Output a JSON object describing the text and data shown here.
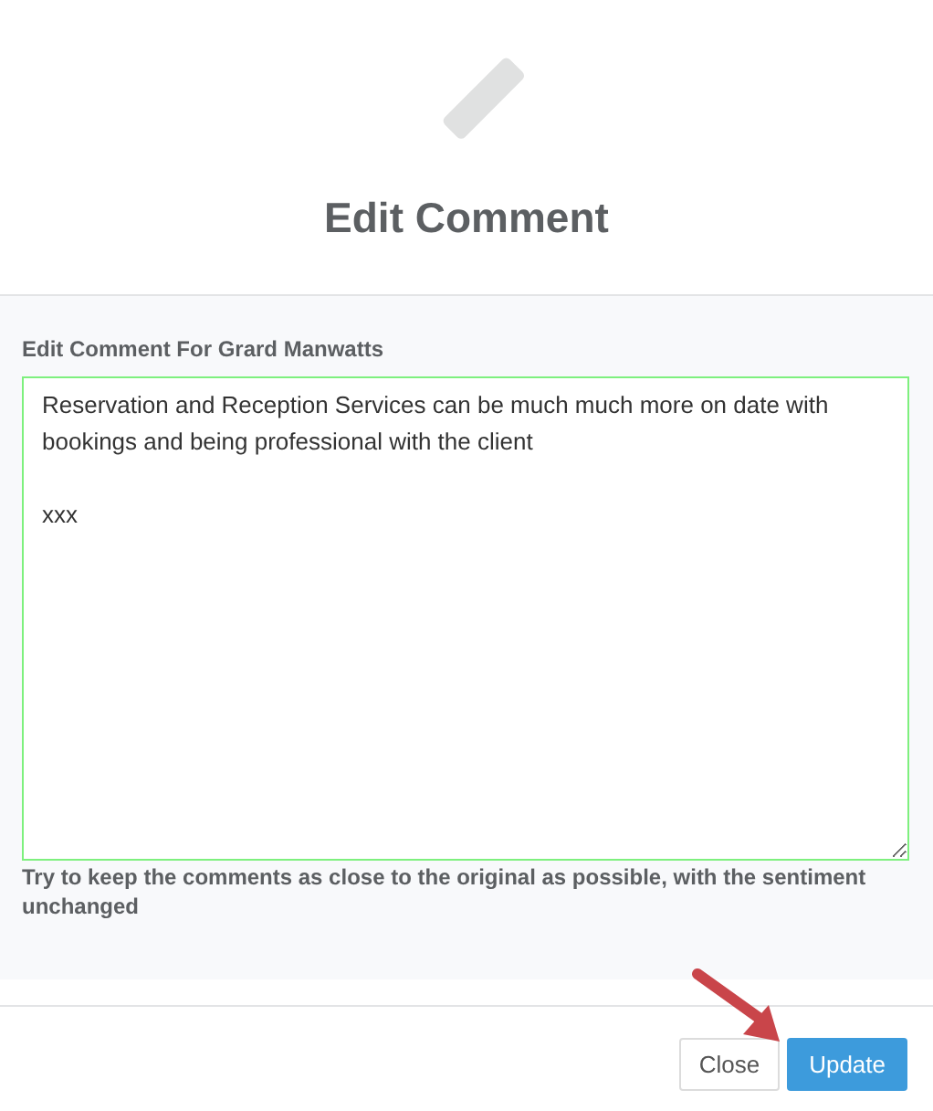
{
  "dialog": {
    "title": "Edit Comment"
  },
  "form": {
    "label": "Edit Comment For Grard Manwatts",
    "comment": "Reservation and Reception Services can be much much more on date with bookings and being professional with the client\n\nxxx",
    "focused": true,
    "hint": "Try to keep the comments as close to the original as possible, with the sentiment unchanged"
  },
  "buttons": [
    {
      "label": "Close",
      "kind": "secondary"
    },
    {
      "label": "Update",
      "kind": "primary"
    }
  ]
}
